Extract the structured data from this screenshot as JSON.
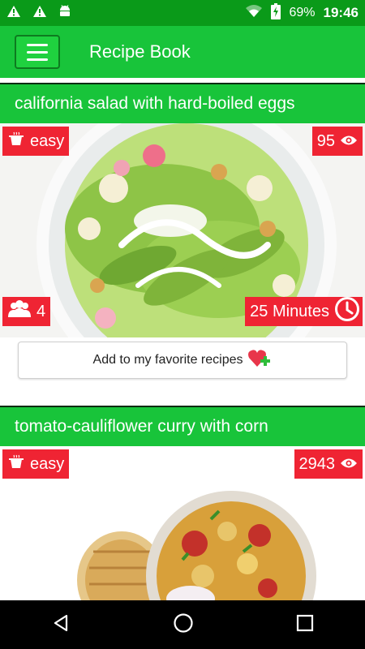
{
  "status": {
    "battery": "69%",
    "time": "19:46"
  },
  "app_bar": {
    "title": "Recipe Book"
  },
  "recipes": [
    {
      "title": "california salad with hard-boiled eggs",
      "difficulty": "easy",
      "views": "95",
      "servings": "4",
      "time": "25 Minutes",
      "favorite_label": "Add to my favorite recipes"
    },
    {
      "title": "tomato-cauliflower curry with corn",
      "difficulty": "easy",
      "views": "2943"
    }
  ],
  "icons": {
    "status": [
      "alert-icon",
      "alert-icon",
      "android-icon",
      "wifi-icon",
      "battery-charging-icon"
    ],
    "badges": [
      "pot-icon",
      "eye-icon",
      "people-icon",
      "clock-icon",
      "heart-plus-icon"
    ],
    "nav": [
      "back-icon",
      "home-icon",
      "recents-icon"
    ]
  },
  "colors": {
    "status_bar": "#0a9a19",
    "app_bar": "#18c43a",
    "badge": "#ef2433"
  }
}
